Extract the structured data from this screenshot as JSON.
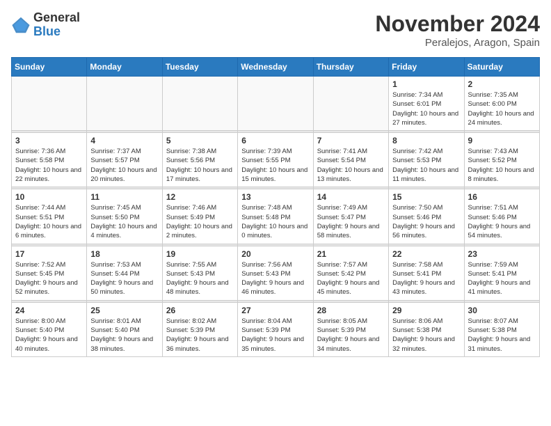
{
  "header": {
    "logo": {
      "line1": "General",
      "line2": "Blue"
    },
    "title": "November 2024",
    "location": "Peralejos, Aragon, Spain"
  },
  "days_of_week": [
    "Sunday",
    "Monday",
    "Tuesday",
    "Wednesday",
    "Thursday",
    "Friday",
    "Saturday"
  ],
  "weeks": [
    {
      "days": [
        {
          "num": "",
          "info": ""
        },
        {
          "num": "",
          "info": ""
        },
        {
          "num": "",
          "info": ""
        },
        {
          "num": "",
          "info": ""
        },
        {
          "num": "",
          "info": ""
        },
        {
          "num": "1",
          "info": "Sunrise: 7:34 AM\nSunset: 6:01 PM\nDaylight: 10 hours and 27 minutes."
        },
        {
          "num": "2",
          "info": "Sunrise: 7:35 AM\nSunset: 6:00 PM\nDaylight: 10 hours and 24 minutes."
        }
      ]
    },
    {
      "days": [
        {
          "num": "3",
          "info": "Sunrise: 7:36 AM\nSunset: 5:58 PM\nDaylight: 10 hours and 22 minutes."
        },
        {
          "num": "4",
          "info": "Sunrise: 7:37 AM\nSunset: 5:57 PM\nDaylight: 10 hours and 20 minutes."
        },
        {
          "num": "5",
          "info": "Sunrise: 7:38 AM\nSunset: 5:56 PM\nDaylight: 10 hours and 17 minutes."
        },
        {
          "num": "6",
          "info": "Sunrise: 7:39 AM\nSunset: 5:55 PM\nDaylight: 10 hours and 15 minutes."
        },
        {
          "num": "7",
          "info": "Sunrise: 7:41 AM\nSunset: 5:54 PM\nDaylight: 10 hours and 13 minutes."
        },
        {
          "num": "8",
          "info": "Sunrise: 7:42 AM\nSunset: 5:53 PM\nDaylight: 10 hours and 11 minutes."
        },
        {
          "num": "9",
          "info": "Sunrise: 7:43 AM\nSunset: 5:52 PM\nDaylight: 10 hours and 8 minutes."
        }
      ]
    },
    {
      "days": [
        {
          "num": "10",
          "info": "Sunrise: 7:44 AM\nSunset: 5:51 PM\nDaylight: 10 hours and 6 minutes."
        },
        {
          "num": "11",
          "info": "Sunrise: 7:45 AM\nSunset: 5:50 PM\nDaylight: 10 hours and 4 minutes."
        },
        {
          "num": "12",
          "info": "Sunrise: 7:46 AM\nSunset: 5:49 PM\nDaylight: 10 hours and 2 minutes."
        },
        {
          "num": "13",
          "info": "Sunrise: 7:48 AM\nSunset: 5:48 PM\nDaylight: 10 hours and 0 minutes."
        },
        {
          "num": "14",
          "info": "Sunrise: 7:49 AM\nSunset: 5:47 PM\nDaylight: 9 hours and 58 minutes."
        },
        {
          "num": "15",
          "info": "Sunrise: 7:50 AM\nSunset: 5:46 PM\nDaylight: 9 hours and 56 minutes."
        },
        {
          "num": "16",
          "info": "Sunrise: 7:51 AM\nSunset: 5:46 PM\nDaylight: 9 hours and 54 minutes."
        }
      ]
    },
    {
      "days": [
        {
          "num": "17",
          "info": "Sunrise: 7:52 AM\nSunset: 5:45 PM\nDaylight: 9 hours and 52 minutes."
        },
        {
          "num": "18",
          "info": "Sunrise: 7:53 AM\nSunset: 5:44 PM\nDaylight: 9 hours and 50 minutes."
        },
        {
          "num": "19",
          "info": "Sunrise: 7:55 AM\nSunset: 5:43 PM\nDaylight: 9 hours and 48 minutes."
        },
        {
          "num": "20",
          "info": "Sunrise: 7:56 AM\nSunset: 5:43 PM\nDaylight: 9 hours and 46 minutes."
        },
        {
          "num": "21",
          "info": "Sunrise: 7:57 AM\nSunset: 5:42 PM\nDaylight: 9 hours and 45 minutes."
        },
        {
          "num": "22",
          "info": "Sunrise: 7:58 AM\nSunset: 5:41 PM\nDaylight: 9 hours and 43 minutes."
        },
        {
          "num": "23",
          "info": "Sunrise: 7:59 AM\nSunset: 5:41 PM\nDaylight: 9 hours and 41 minutes."
        }
      ]
    },
    {
      "days": [
        {
          "num": "24",
          "info": "Sunrise: 8:00 AM\nSunset: 5:40 PM\nDaylight: 9 hours and 40 minutes."
        },
        {
          "num": "25",
          "info": "Sunrise: 8:01 AM\nSunset: 5:40 PM\nDaylight: 9 hours and 38 minutes."
        },
        {
          "num": "26",
          "info": "Sunrise: 8:02 AM\nSunset: 5:39 PM\nDaylight: 9 hours and 36 minutes."
        },
        {
          "num": "27",
          "info": "Sunrise: 8:04 AM\nSunset: 5:39 PM\nDaylight: 9 hours and 35 minutes."
        },
        {
          "num": "28",
          "info": "Sunrise: 8:05 AM\nSunset: 5:39 PM\nDaylight: 9 hours and 34 minutes."
        },
        {
          "num": "29",
          "info": "Sunrise: 8:06 AM\nSunset: 5:38 PM\nDaylight: 9 hours and 32 minutes."
        },
        {
          "num": "30",
          "info": "Sunrise: 8:07 AM\nSunset: 5:38 PM\nDaylight: 9 hours and 31 minutes."
        }
      ]
    }
  ]
}
